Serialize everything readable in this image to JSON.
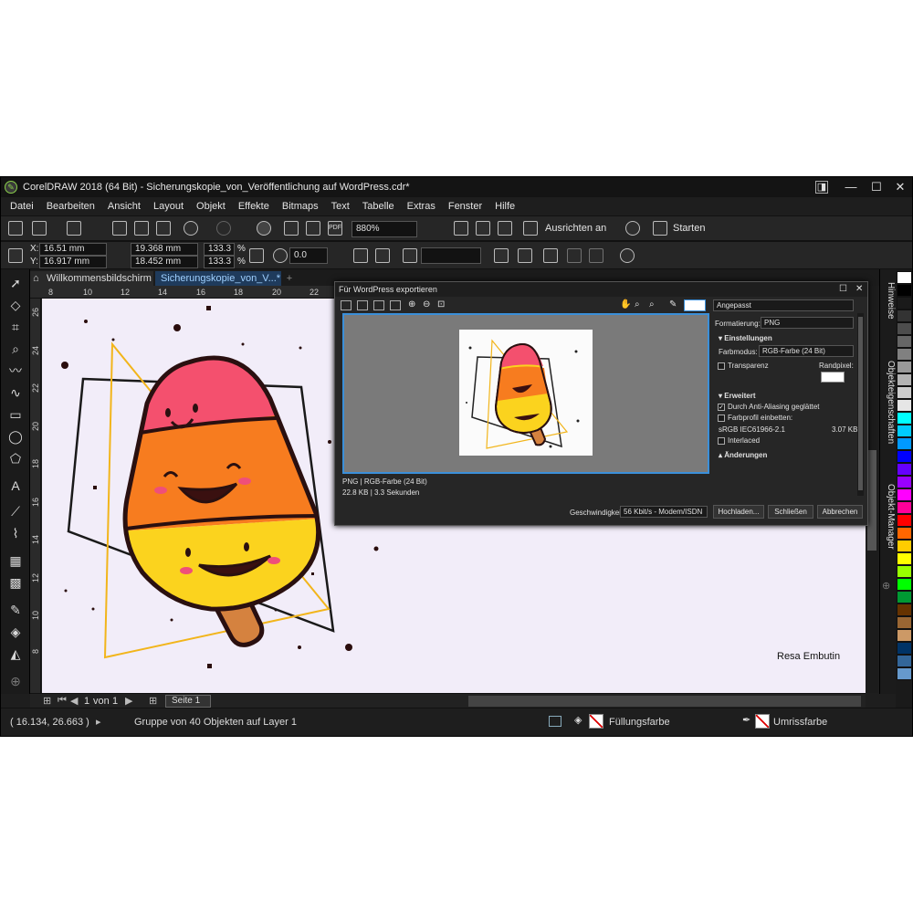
{
  "window": {
    "title": "CorelDRAW 2018 (64 Bit) - Sicherungskopie_von_Veröffentlichung auf WordPress.cdr*",
    "minimize": "—",
    "maximize": "☐",
    "close": "✕"
  },
  "menu": [
    "Datei",
    "Bearbeiten",
    "Ansicht",
    "Layout",
    "Objekt",
    "Effekte",
    "Bitmaps",
    "Text",
    "Tabelle",
    "Extras",
    "Fenster",
    "Hilfe"
  ],
  "toolbar": {
    "zoom_value": "880%",
    "align_label": "Ausrichten an",
    "start_label": "Starten"
  },
  "propbar": {
    "x_label": "X:",
    "x_value": "16.51 mm",
    "y_label": "Y:",
    "y_value": "16.917 mm",
    "w_value": "19.368 mm",
    "h_value": "18.452 mm",
    "scale_w": "133.3",
    "scale_h": "133.3",
    "percent": "%",
    "rotation": "0.0"
  },
  "tabs": {
    "welcome": "Willkommensbildschirm",
    "document": "Sicherungskopie_von_V...*"
  },
  "ruler": {
    "h": [
      "8",
      "10",
      "12",
      "14",
      "16",
      "18",
      "20",
      "22"
    ],
    "v": [
      "26",
      "24",
      "22",
      "20",
      "18",
      "16",
      "14",
      "12",
      "10",
      "8"
    ]
  },
  "canvas": {
    "signature": "Resa Embutin"
  },
  "pagenav": {
    "page_num": "1",
    "of_label": "von",
    "page_total": "1",
    "page_tab": "Seite 1"
  },
  "status": {
    "coords": "( 16.134, 26.663 )",
    "selection": "Gruppe von 40 Objekten auf Layer 1",
    "fill_label": "Füllungsfarbe",
    "outline_label": "Umrissfarbe"
  },
  "dockers": {
    "hints": "Hinweise",
    "props": "Objekteigenschaften",
    "manager": "Objekt-Manager"
  },
  "dialog": {
    "title": "Für WordPress exportieren",
    "preset": "Angepasst",
    "format_label": "Formatierung:",
    "format_value": "PNG",
    "settings_header": "Einstellungen",
    "colormode_label": "Farbmodus:",
    "colormode_value": "RGB-Farbe (24 Bit)",
    "transparency": "Transparenz",
    "matte_label": "Randpixel:",
    "advanced_header": "Erweitert",
    "antialias": "Durch Anti-Aliasing geglättet",
    "embed_profile": "Farbprofil einbetten:",
    "profile_name": "sRGB IEC61966-2.1",
    "profile_size": "3.07 KB",
    "interlaced": "Interlaced",
    "changes_header": "Änderungen",
    "info_line1": "PNG  |  RGB-Farbe (24 Bit)",
    "info_line2": "22.8 KB  |  3.3 Sekunden",
    "speed_label": "Geschwindigkeit:",
    "speed_value": "56 Kbit/s - Modem/ISDN",
    "upload": "Hochladen...",
    "close": "Schließen",
    "cancel": "Abbrechen"
  },
  "colors": {
    "accent": "#3b8fd9",
    "popsicle_top": "#f4506e",
    "popsicle_mid": "#f77c1f",
    "popsicle_bottom": "#fbd31e",
    "stick": "#d5823f"
  },
  "palette": [
    "#ffffff",
    "#000000",
    "#1a1a1a",
    "#333333",
    "#4d4d4d",
    "#666666",
    "#808080",
    "#999999",
    "#b3b3b3",
    "#cccccc",
    "#e6e6e6",
    "#00ffff",
    "#00ccff",
    "#0099ff",
    "#0000ff",
    "#6600ff",
    "#9900ff",
    "#ff00ff",
    "#ff0099",
    "#ff0000",
    "#ff6600",
    "#ffcc00",
    "#ffff00",
    "#99ff00",
    "#00ff00",
    "#009933",
    "#663300",
    "#996633",
    "#cc9966",
    "#003366",
    "#336699",
    "#6699cc"
  ]
}
